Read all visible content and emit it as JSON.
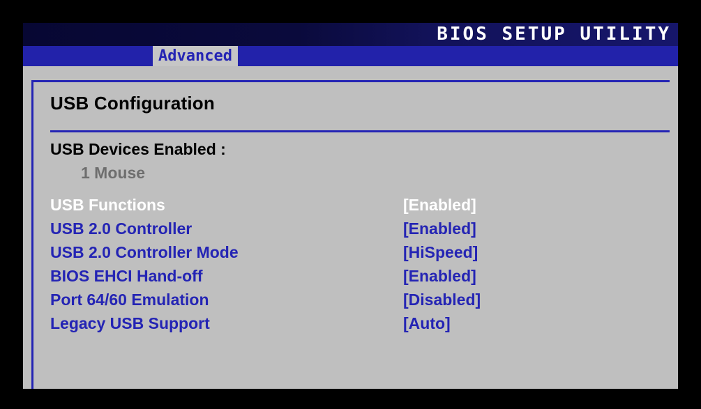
{
  "window": {
    "title": "BIOS SETUP UTILITY"
  },
  "menu": {
    "tabs": [
      {
        "label": "Advanced",
        "active": true
      }
    ]
  },
  "panel": {
    "heading": "USB Configuration",
    "devices": {
      "label": "USB Devices Enabled :",
      "value": "1 Mouse"
    },
    "settings": [
      {
        "name": "USB Functions",
        "value": "[Enabled]",
        "selected": true
      },
      {
        "name": "USB 2.0 Controller",
        "value": "[Enabled]",
        "selected": false
      },
      {
        "name": "USB 2.0 Controller Mode",
        "value": "[HiSpeed]",
        "selected": false
      },
      {
        "name": "BIOS EHCI Hand-off",
        "value": "[Enabled]",
        "selected": false
      },
      {
        "name": "Port 64/60 Emulation",
        "value": "[Disabled]",
        "selected": false
      },
      {
        "name": "Legacy USB Support",
        "value": "[Auto]",
        "selected": false
      }
    ]
  },
  "colors": {
    "screen_border": "#000000",
    "panel_background": "#bfbfbf",
    "title_bar_dark": "#070733",
    "title_bar_light": "#16166b",
    "menu_bar": "#2222aa",
    "accent_blue": "#2424b4",
    "tab_background": "#c6c6c6",
    "selected_text": "#ffffff",
    "heading_text": "#000000",
    "dim_text": "#6e6e6e"
  }
}
